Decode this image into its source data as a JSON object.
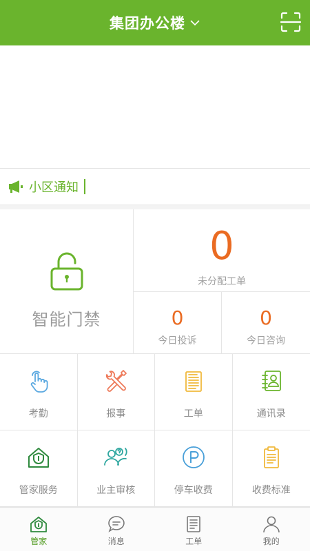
{
  "header": {
    "title": "集团办公楼"
  },
  "notice": {
    "label": "小区通知"
  },
  "access": {
    "label": "智能门禁"
  },
  "stats": {
    "unassigned": {
      "value": "0",
      "label": "未分配工单"
    },
    "complaints": {
      "value": "0",
      "label": "今日投诉"
    },
    "consults": {
      "value": "0",
      "label": "今日咨询"
    }
  },
  "grid": [
    {
      "label": "考勤",
      "icon": "tap-hand-icon",
      "color": "#5aa8e0"
    },
    {
      "label": "报事",
      "icon": "tools-icon",
      "color": "#ee7a5a"
    },
    {
      "label": "工单",
      "icon": "document-icon",
      "color": "#f1b93d"
    },
    {
      "label": "通讯录",
      "icon": "contacts-icon",
      "color": "#6ab42d"
    },
    {
      "label": "管家服务",
      "icon": "house-shield-icon",
      "color": "#2f8a3e"
    },
    {
      "label": "业主审核",
      "icon": "users-question-icon",
      "color": "#2fa7a0"
    },
    {
      "label": "停车收费",
      "icon": "parking-icon",
      "color": "#4aa0d9"
    },
    {
      "label": "收费标准",
      "icon": "clipboard-icon",
      "color": "#f1b93d"
    }
  ],
  "nav": [
    {
      "label": "管家",
      "icon": "house-shield-icon",
      "active": true
    },
    {
      "label": "消息",
      "icon": "chat-icon",
      "active": false
    },
    {
      "label": "工单",
      "icon": "document-icon",
      "active": false
    },
    {
      "label": "我的",
      "icon": "person-icon",
      "active": false
    }
  ],
  "colors": {
    "brand": "#6ab42d",
    "accent": "#ea6b22"
  }
}
